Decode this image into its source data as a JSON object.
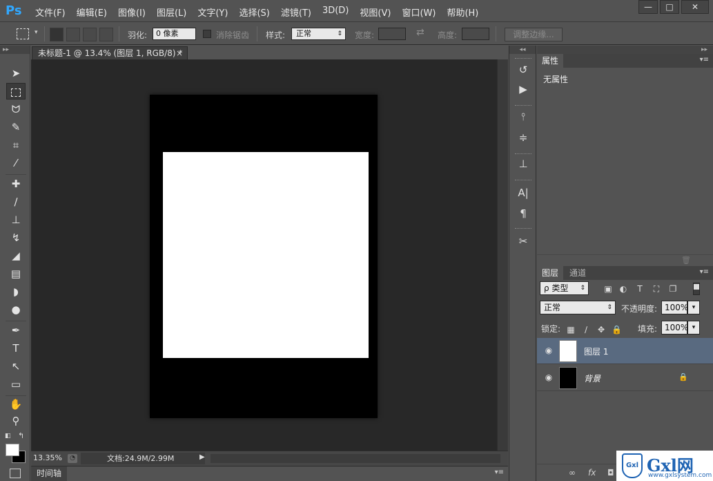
{
  "app": {
    "logo": "Ps"
  },
  "menu": [
    "文件(F)",
    "编辑(E)",
    "图像(I)",
    "图层(L)",
    "文字(Y)",
    "选择(S)",
    "滤镜(T)",
    "3D(D)",
    "视图(V)",
    "窗口(W)",
    "帮助(H)"
  ],
  "window_controls": {
    "minimize": "—",
    "restore": "□",
    "close": "✕"
  },
  "options": {
    "feather_label": "羽化:",
    "feather_value": "0 像素",
    "antialias_label": "消除锯齿",
    "style_label": "样式:",
    "style_value": "正常",
    "width_label": "宽度:",
    "height_label": "高度:",
    "swap_icon": "⇄",
    "refine_edge": "调整边缘..."
  },
  "document": {
    "tab_title": "未标题-1 @ 13.4% (图层 1, RGB/8) *",
    "tab_close": "×",
    "zoom": "13.35%",
    "doc_info": "文档:24.9M/2.99M",
    "status_arrow": "▶"
  },
  "timeline": {
    "label": "时间轴",
    "menu": "▾≡"
  },
  "panels": {
    "collapse_left": "▸▸",
    "collapse_dock": "◂◂",
    "properties": {
      "tab": "属性",
      "menu": "▾≡",
      "empty": "无属性"
    },
    "layers": {
      "tab_layers": "图层",
      "tab_channels": "通道",
      "menu": "▾≡",
      "filter_kind": "ρ 类型",
      "blend_mode": "正常",
      "opacity_label": "不透明度:",
      "opacity_value": "100%",
      "lock_label": "锁定:",
      "fill_label": "填充:",
      "fill_value": "100%",
      "items": [
        {
          "name": "图层 1",
          "selected": true,
          "locked": false,
          "thumb": "#ffffff"
        },
        {
          "name": "背景",
          "selected": false,
          "locked": true,
          "thumb": "#000000"
        }
      ],
      "footer_icons": [
        "∞",
        "fx",
        "◘",
        "◐",
        "▭",
        "▢",
        "🗑"
      ]
    }
  },
  "watermark": {
    "brand": "Gxl网",
    "url": "www.gxlsystem.com",
    "shield": "Gxl"
  },
  "colors": {
    "foreground": "#ffffff",
    "background": "#000000",
    "accent": "#31a8ff"
  }
}
